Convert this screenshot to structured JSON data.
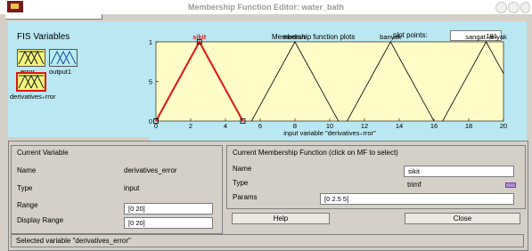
{
  "window": {
    "title": "Membership Function Editor: water_bath"
  },
  "fis_panel": {
    "title": "FIS Variables",
    "variables": [
      {
        "name": "error",
        "kind": "input"
      },
      {
        "name": "output1",
        "kind": "output"
      },
      {
        "name": "derivatives_error",
        "label": "derivatives₊rror",
        "kind": "input",
        "selected": true
      }
    ]
  },
  "plot": {
    "caption": "Membership function plots",
    "plot_points_label": "plot points:",
    "plot_points_value": "181"
  },
  "chart_data": {
    "type": "line",
    "title": "",
    "xlabel": "input variable \"derivatives₊rror\"",
    "ylabel": "",
    "xlim": [
      0,
      20
    ],
    "ylim": [
      0,
      1
    ],
    "xticks": [
      "0",
      "2",
      "4",
      "6",
      "8",
      "10",
      "12",
      "14",
      "16",
      "18",
      "20"
    ],
    "yticks": [
      "0",
      "0.5",
      "1"
    ],
    "series": [
      {
        "name": "sikit",
        "params": [
          0,
          2.5,
          5
        ],
        "color": "#e01414",
        "selected": true
      },
      {
        "name": "medium",
        "params": [
          5.5,
          8,
          10.5
        ],
        "color": "#000000",
        "selected": false
      },
      {
        "name": "banyak",
        "params": [
          11,
          13.5,
          16
        ],
        "color": "#000000",
        "selected": false
      },
      {
        "name": "sangat₊anyak",
        "params": [
          16.5,
          19,
          21.5
        ],
        "color": "#000000",
        "selected": false
      }
    ]
  },
  "current_variable": {
    "title": "Current Variable",
    "name_label": "Name",
    "name_value": "derivatives_error",
    "type_label": "Type",
    "type_value": "input",
    "range_label": "Range",
    "range_value": "[0 20]",
    "display_range_label": "Display Range",
    "display_range_value": "[0 20]"
  },
  "current_mf": {
    "title": "Current Membership Function (click on MF to select)",
    "name_label": "Name",
    "name_value": "sikit",
    "type_label": "Type",
    "type_value": "trimf",
    "params_label": "Params",
    "params_value": "[0 2.5 5]"
  },
  "buttons": {
    "help": "Help",
    "close": "Close"
  },
  "status": {
    "text": "Selected variable \"derivatives_error\""
  },
  "colors": {
    "window_bg": "#d4d0c8",
    "plot_bg": "#fffcc8",
    "panel_bg": "#b9e7f2",
    "selected_mf": "#e01414"
  }
}
